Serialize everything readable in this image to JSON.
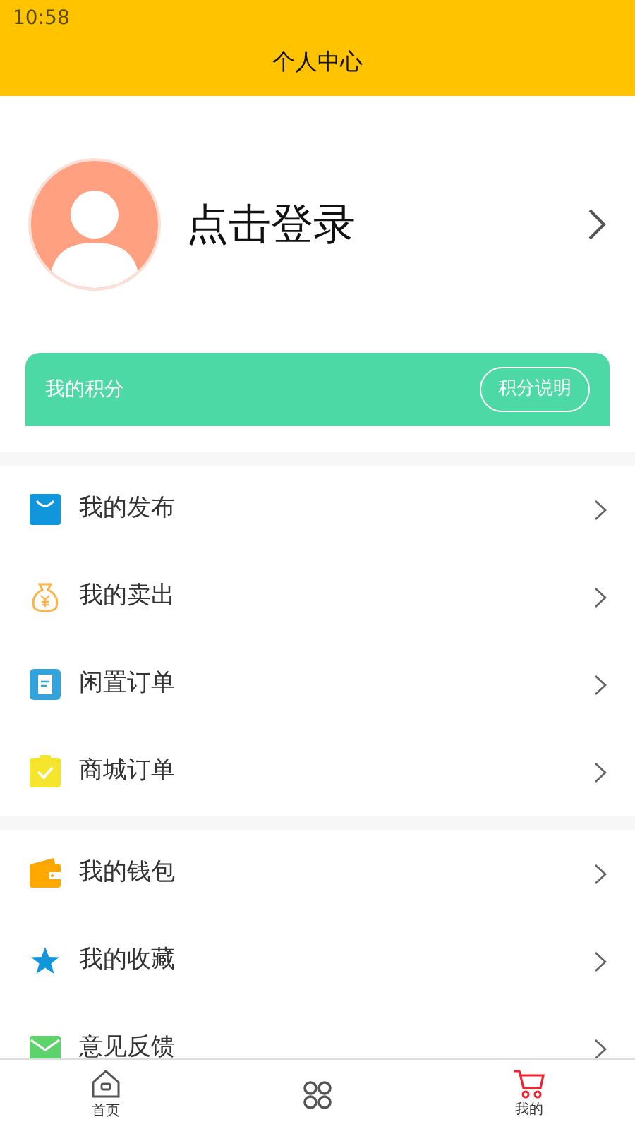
{
  "status_bar": {
    "time": "10:58"
  },
  "header": {
    "title": "个人中心"
  },
  "profile": {
    "login_text": "点击登录"
  },
  "points": {
    "label": "我的积分",
    "button": "积分说明"
  },
  "menu_groups": [
    {
      "items": [
        {
          "label": "我的发布"
        },
        {
          "label": "我的卖出"
        },
        {
          "label": "闲置订单"
        },
        {
          "label": "商城订单"
        }
      ]
    },
    {
      "items": [
        {
          "label": "我的钱包"
        },
        {
          "label": "我的收藏"
        },
        {
          "label": "意见反馈"
        }
      ]
    }
  ],
  "tab_bar": [
    {
      "label": "首页",
      "selected": false
    },
    {
      "selected": false
    },
    {
      "label": "我的",
      "selected": true
    }
  ]
}
